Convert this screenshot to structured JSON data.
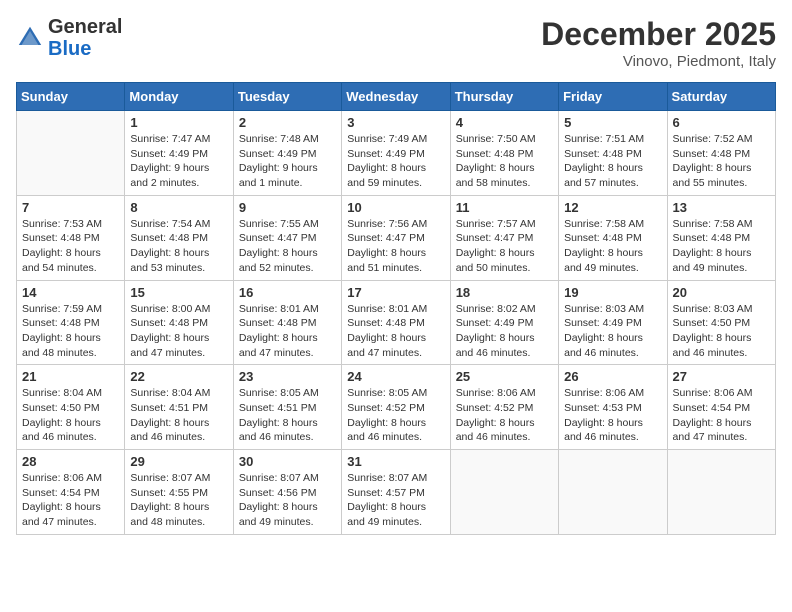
{
  "header": {
    "logo_general": "General",
    "logo_blue": "Blue",
    "month_title": "December 2025",
    "location": "Vinovo, Piedmont, Italy"
  },
  "weekdays": [
    "Sunday",
    "Monday",
    "Tuesday",
    "Wednesday",
    "Thursday",
    "Friday",
    "Saturday"
  ],
  "weeks": [
    [
      {
        "day": "",
        "sunrise": "",
        "sunset": "",
        "daylight": ""
      },
      {
        "day": "1",
        "sunrise": "Sunrise: 7:47 AM",
        "sunset": "Sunset: 4:49 PM",
        "daylight": "Daylight: 9 hours and 2 minutes."
      },
      {
        "day": "2",
        "sunrise": "Sunrise: 7:48 AM",
        "sunset": "Sunset: 4:49 PM",
        "daylight": "Daylight: 9 hours and 1 minute."
      },
      {
        "day": "3",
        "sunrise": "Sunrise: 7:49 AM",
        "sunset": "Sunset: 4:49 PM",
        "daylight": "Daylight: 8 hours and 59 minutes."
      },
      {
        "day": "4",
        "sunrise": "Sunrise: 7:50 AM",
        "sunset": "Sunset: 4:48 PM",
        "daylight": "Daylight: 8 hours and 58 minutes."
      },
      {
        "day": "5",
        "sunrise": "Sunrise: 7:51 AM",
        "sunset": "Sunset: 4:48 PM",
        "daylight": "Daylight: 8 hours and 57 minutes."
      },
      {
        "day": "6",
        "sunrise": "Sunrise: 7:52 AM",
        "sunset": "Sunset: 4:48 PM",
        "daylight": "Daylight: 8 hours and 55 minutes."
      }
    ],
    [
      {
        "day": "7",
        "sunrise": "Sunrise: 7:53 AM",
        "sunset": "Sunset: 4:48 PM",
        "daylight": "Daylight: 8 hours and 54 minutes."
      },
      {
        "day": "8",
        "sunrise": "Sunrise: 7:54 AM",
        "sunset": "Sunset: 4:48 PM",
        "daylight": "Daylight: 8 hours and 53 minutes."
      },
      {
        "day": "9",
        "sunrise": "Sunrise: 7:55 AM",
        "sunset": "Sunset: 4:47 PM",
        "daylight": "Daylight: 8 hours and 52 minutes."
      },
      {
        "day": "10",
        "sunrise": "Sunrise: 7:56 AM",
        "sunset": "Sunset: 4:47 PM",
        "daylight": "Daylight: 8 hours and 51 minutes."
      },
      {
        "day": "11",
        "sunrise": "Sunrise: 7:57 AM",
        "sunset": "Sunset: 4:47 PM",
        "daylight": "Daylight: 8 hours and 50 minutes."
      },
      {
        "day": "12",
        "sunrise": "Sunrise: 7:58 AM",
        "sunset": "Sunset: 4:48 PM",
        "daylight": "Daylight: 8 hours and 49 minutes."
      },
      {
        "day": "13",
        "sunrise": "Sunrise: 7:58 AM",
        "sunset": "Sunset: 4:48 PM",
        "daylight": "Daylight: 8 hours and 49 minutes."
      }
    ],
    [
      {
        "day": "14",
        "sunrise": "Sunrise: 7:59 AM",
        "sunset": "Sunset: 4:48 PM",
        "daylight": "Daylight: 8 hours and 48 minutes."
      },
      {
        "day": "15",
        "sunrise": "Sunrise: 8:00 AM",
        "sunset": "Sunset: 4:48 PM",
        "daylight": "Daylight: 8 hours and 47 minutes."
      },
      {
        "day": "16",
        "sunrise": "Sunrise: 8:01 AM",
        "sunset": "Sunset: 4:48 PM",
        "daylight": "Daylight: 8 hours and 47 minutes."
      },
      {
        "day": "17",
        "sunrise": "Sunrise: 8:01 AM",
        "sunset": "Sunset: 4:48 PM",
        "daylight": "Daylight: 8 hours and 47 minutes."
      },
      {
        "day": "18",
        "sunrise": "Sunrise: 8:02 AM",
        "sunset": "Sunset: 4:49 PM",
        "daylight": "Daylight: 8 hours and 46 minutes."
      },
      {
        "day": "19",
        "sunrise": "Sunrise: 8:03 AM",
        "sunset": "Sunset: 4:49 PM",
        "daylight": "Daylight: 8 hours and 46 minutes."
      },
      {
        "day": "20",
        "sunrise": "Sunrise: 8:03 AM",
        "sunset": "Sunset: 4:50 PM",
        "daylight": "Daylight: 8 hours and 46 minutes."
      }
    ],
    [
      {
        "day": "21",
        "sunrise": "Sunrise: 8:04 AM",
        "sunset": "Sunset: 4:50 PM",
        "daylight": "Daylight: 8 hours and 46 minutes."
      },
      {
        "day": "22",
        "sunrise": "Sunrise: 8:04 AM",
        "sunset": "Sunset: 4:51 PM",
        "daylight": "Daylight: 8 hours and 46 minutes."
      },
      {
        "day": "23",
        "sunrise": "Sunrise: 8:05 AM",
        "sunset": "Sunset: 4:51 PM",
        "daylight": "Daylight: 8 hours and 46 minutes."
      },
      {
        "day": "24",
        "sunrise": "Sunrise: 8:05 AM",
        "sunset": "Sunset: 4:52 PM",
        "daylight": "Daylight: 8 hours and 46 minutes."
      },
      {
        "day": "25",
        "sunrise": "Sunrise: 8:06 AM",
        "sunset": "Sunset: 4:52 PM",
        "daylight": "Daylight: 8 hours and 46 minutes."
      },
      {
        "day": "26",
        "sunrise": "Sunrise: 8:06 AM",
        "sunset": "Sunset: 4:53 PM",
        "daylight": "Daylight: 8 hours and 46 minutes."
      },
      {
        "day": "27",
        "sunrise": "Sunrise: 8:06 AM",
        "sunset": "Sunset: 4:54 PM",
        "daylight": "Daylight: 8 hours and 47 minutes."
      }
    ],
    [
      {
        "day": "28",
        "sunrise": "Sunrise: 8:06 AM",
        "sunset": "Sunset: 4:54 PM",
        "daylight": "Daylight: 8 hours and 47 minutes."
      },
      {
        "day": "29",
        "sunrise": "Sunrise: 8:07 AM",
        "sunset": "Sunset: 4:55 PM",
        "daylight": "Daylight: 8 hours and 48 minutes."
      },
      {
        "day": "30",
        "sunrise": "Sunrise: 8:07 AM",
        "sunset": "Sunset: 4:56 PM",
        "daylight": "Daylight: 8 hours and 49 minutes."
      },
      {
        "day": "31",
        "sunrise": "Sunrise: 8:07 AM",
        "sunset": "Sunset: 4:57 PM",
        "daylight": "Daylight: 8 hours and 49 minutes."
      },
      {
        "day": "",
        "sunrise": "",
        "sunset": "",
        "daylight": ""
      },
      {
        "day": "",
        "sunrise": "",
        "sunset": "",
        "daylight": ""
      },
      {
        "day": "",
        "sunrise": "",
        "sunset": "",
        "daylight": ""
      }
    ]
  ]
}
